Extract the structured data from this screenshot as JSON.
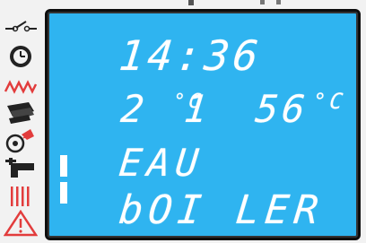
{
  "status_icons": [
    {
      "name": "switch-icon"
    },
    {
      "name": "clock-icon"
    },
    {
      "name": "heating-zigzag-icon"
    },
    {
      "name": "radiator-icon"
    },
    {
      "name": "pump-icon"
    },
    {
      "name": "water-tap-icon"
    },
    {
      "name": "heater-bars-icon"
    },
    {
      "name": "warning-icon"
    }
  ],
  "display": {
    "time": "14:36",
    "temperature_1": "2 1",
    "temperature_1_unit": "°C",
    "temperature_2": "56",
    "temperature_2_unit": "°C",
    "mode": "EAU",
    "label": "bOI LER"
  },
  "colors": {
    "lcd_background": "#2fb4f0",
    "segment": "#ffffff",
    "heating_icon": "#e23c3c",
    "warning_icon": "#e23c3c"
  }
}
